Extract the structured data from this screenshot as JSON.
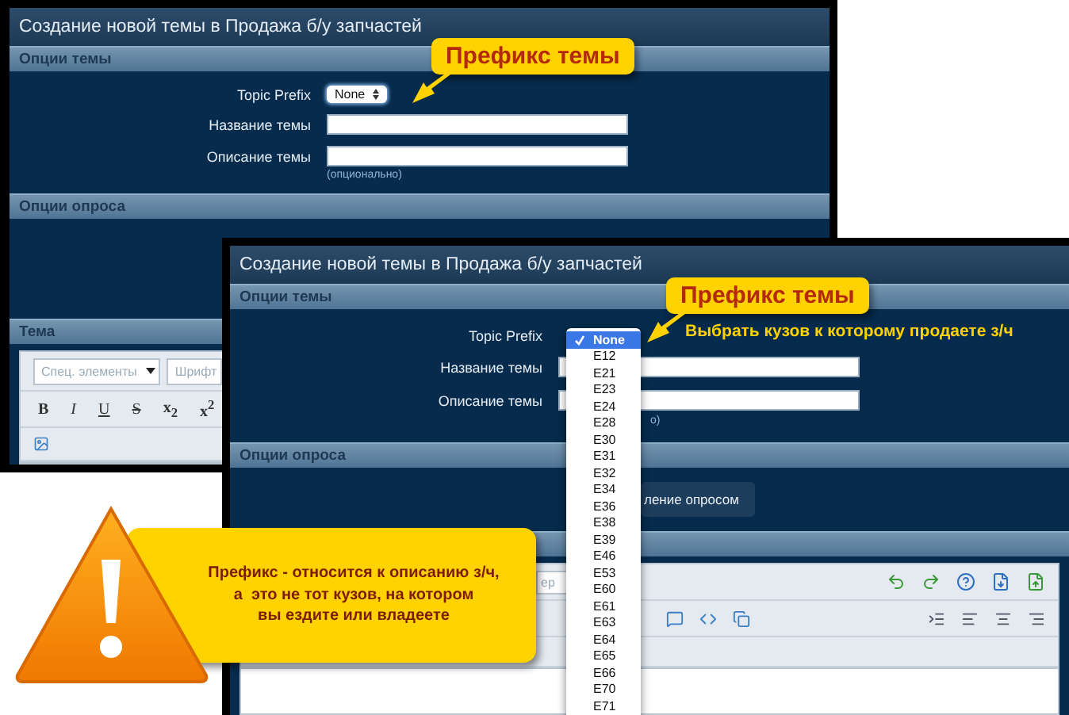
{
  "back_window": {
    "title": "Создание новой темы в Продажа б/у запчастей",
    "topic_section": "Опции темы",
    "prefix": {
      "label": "Topic Prefix",
      "value": "None"
    },
    "fields": [
      {
        "label": "Название темы"
      },
      {
        "label": "Описание темы"
      }
    ],
    "hint": "(опционально)",
    "poll_section": "Опции опроса",
    "subject_section": "Тема",
    "editor": {
      "menus": [
        {
          "placeholder": "Спец. элементы",
          "caret": true
        },
        {
          "placeholder": "Шрифт",
          "caret": false
        }
      ],
      "format_buttons": [
        {
          "label": "B",
          "kind": "bold"
        },
        {
          "label": "I",
          "kind": "italic"
        },
        {
          "label": "U",
          "kind": "underline"
        },
        {
          "label": "S",
          "kind": "strike"
        },
        {
          "label": "x$_{2}$",
          "kind": "sub"
        },
        {
          "label": "x$^{2}$",
          "kind": "sup"
        }
      ]
    }
  },
  "front_window": {
    "title": "Создание новой темы в Продажа б/у запчастей",
    "topic_section": "Опции темы",
    "prefix_label": "Topic Prefix",
    "fields": [
      {
        "label": "Название темы"
      },
      {
        "label": "Описание темы"
      }
    ],
    "hint": "о)",
    "poll_section": "Опции опроса",
    "poll_button": "ление опросом",
    "editor": {
      "search_placeholder": "ер"
    }
  },
  "prefix_dropdown": {
    "options": [
      {
        "label": "None",
        "selected": true
      },
      {
        "label": "E12",
        "selected": false
      },
      {
        "label": "E21",
        "selected": false
      },
      {
        "label": "E23",
        "selected": false
      },
      {
        "label": "E24",
        "selected": false
      },
      {
        "label": "E28",
        "selected": false
      },
      {
        "label": "E30",
        "selected": false
      },
      {
        "label": "E31",
        "selected": false
      },
      {
        "label": "E32",
        "selected": false
      },
      {
        "label": "E34",
        "selected": false
      },
      {
        "label": "E36",
        "selected": false
      },
      {
        "label": "E38",
        "selected": false
      },
      {
        "label": "E39",
        "selected": false
      },
      {
        "label": "E46",
        "selected": false
      },
      {
        "label": "E53",
        "selected": false
      },
      {
        "label": "E60",
        "selected": false
      },
      {
        "label": "E61",
        "selected": false
      },
      {
        "label": "E63",
        "selected": false
      },
      {
        "label": "E64",
        "selected": false
      },
      {
        "label": "E65",
        "selected": false
      },
      {
        "label": "E66",
        "selected": false
      },
      {
        "label": "E70",
        "selected": false
      },
      {
        "label": "E71",
        "selected": false
      }
    ]
  },
  "callouts": [
    {
      "text": "Префикс темы"
    },
    {
      "text": "Префикс темы",
      "note": "Выбрать кузов к которому продаете з/ч"
    }
  ],
  "warning": {
    "text": "Префикс - относится к описанию з/ч,\nа  это не тот кузов, на котором\nвы ездите или владеете"
  }
}
